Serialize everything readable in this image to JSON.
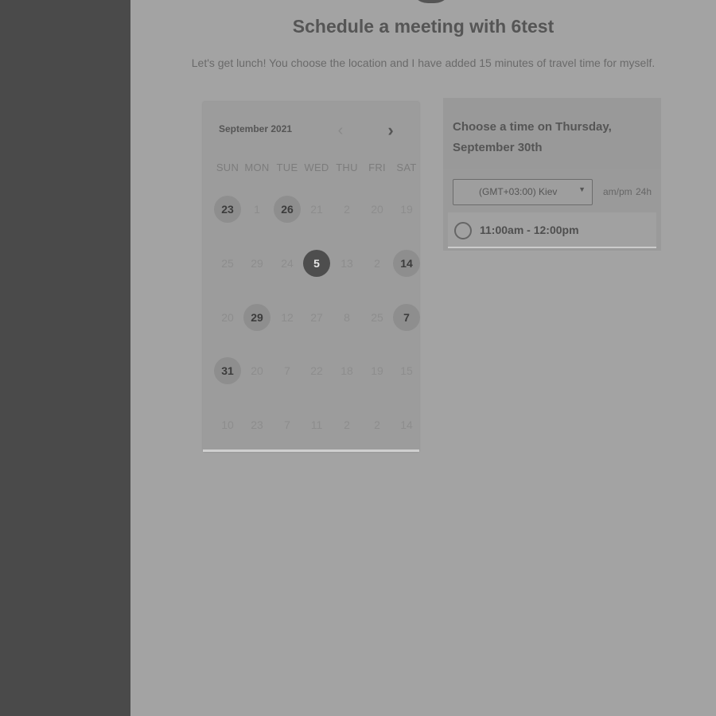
{
  "page": {
    "title": "Schedule a meeting with 6test",
    "subtitle": "Let's get lunch! You choose the location and I have added 15 minutes of travel time for myself."
  },
  "calendar": {
    "month_label": "September 2021",
    "prev_icon": "‹",
    "next_icon": "›",
    "weekdays": [
      "SUN",
      "MON",
      "TUE",
      "WED",
      "THU",
      "FRI",
      "SAT"
    ],
    "weeks": [
      [
        {
          "d": "23",
          "state": "available"
        },
        {
          "d": "1",
          "state": "disabled"
        },
        {
          "d": "26",
          "state": "available"
        },
        {
          "d": "21",
          "state": "disabled"
        },
        {
          "d": "2",
          "state": "disabled"
        },
        {
          "d": "20",
          "state": "disabled"
        },
        {
          "d": "19",
          "state": "disabled"
        }
      ],
      [
        {
          "d": "25",
          "state": "disabled"
        },
        {
          "d": "29",
          "state": "disabled"
        },
        {
          "d": "24",
          "state": "disabled"
        },
        {
          "d": "5",
          "state": "selected"
        },
        {
          "d": "13",
          "state": "disabled"
        },
        {
          "d": "2",
          "state": "disabled"
        },
        {
          "d": "14",
          "state": "available"
        }
      ],
      [
        {
          "d": "20",
          "state": "disabled"
        },
        {
          "d": "29",
          "state": "available"
        },
        {
          "d": "12",
          "state": "disabled"
        },
        {
          "d": "27",
          "state": "disabled"
        },
        {
          "d": "8",
          "state": "disabled"
        },
        {
          "d": "25",
          "state": "disabled"
        },
        {
          "d": "7",
          "state": "available"
        }
      ],
      [
        {
          "d": "31",
          "state": "available"
        },
        {
          "d": "20",
          "state": "disabled"
        },
        {
          "d": "7",
          "state": "disabled"
        },
        {
          "d": "22",
          "state": "disabled"
        },
        {
          "d": "18",
          "state": "disabled"
        },
        {
          "d": "19",
          "state": "disabled"
        },
        {
          "d": "15",
          "state": "disabled"
        }
      ],
      [
        {
          "d": "10",
          "state": "disabled"
        },
        {
          "d": "23",
          "state": "disabled"
        },
        {
          "d": "7",
          "state": "disabled"
        },
        {
          "d": "11",
          "state": "disabled"
        },
        {
          "d": "2",
          "state": "disabled"
        },
        {
          "d": "2",
          "state": "disabled"
        },
        {
          "d": "14",
          "state": "disabled"
        }
      ]
    ]
  },
  "time_panel": {
    "title": "Choose a time on Thursday, September 30th",
    "timezone": "(GMT+03:00) Kiev",
    "ampm_label": "am/pm",
    "h24_label": "24h",
    "slots": [
      "11:00am - 12:00pm"
    ]
  },
  "colors": {
    "background": "#a3a3a3",
    "sidebar": "#4a4a4a",
    "selected_day": "#4e4e4e",
    "available_day": "#8e8e8e"
  }
}
